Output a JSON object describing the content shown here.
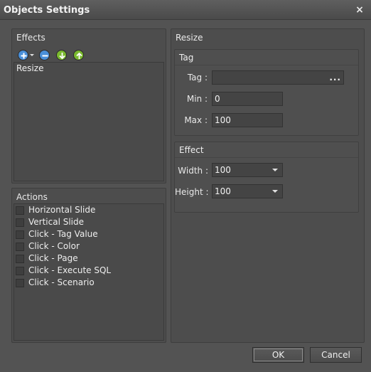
{
  "window": {
    "title": "Objects Settings",
    "close_symbol": "×"
  },
  "effects_panel": {
    "header": "Effects",
    "toolbar": [
      {
        "icon": "add-icon",
        "color": "#4a8fd8"
      },
      {
        "icon": "remove-icon",
        "color": "#4a8fd8"
      },
      {
        "icon": "move-down-icon",
        "color": "#7ab92e"
      },
      {
        "icon": "move-up-icon",
        "color": "#7ab92e"
      }
    ],
    "items": [
      "Resize"
    ]
  },
  "actions_panel": {
    "header": "Actions",
    "items": [
      "Horizontal Slide",
      "Vertical Slide",
      "Click - Tag Value",
      "Click - Color",
      "Click - Page",
      "Click - Execute SQL",
      "Click - Scenario"
    ]
  },
  "resize_panel": {
    "header": "Resize",
    "tag_group": {
      "header": "Tag",
      "tag_label": "Tag :",
      "tag_value": "",
      "tag_button": "...",
      "min_label": "Min :",
      "min_value": "0",
      "max_label": "Max :",
      "max_value": "100"
    },
    "effect_group": {
      "header": "Effect",
      "width_label": "Width :",
      "width_value": "100",
      "height_label": "Height :",
      "height_value": "100"
    }
  },
  "buttons": {
    "ok": "OK",
    "cancel": "Cancel"
  }
}
